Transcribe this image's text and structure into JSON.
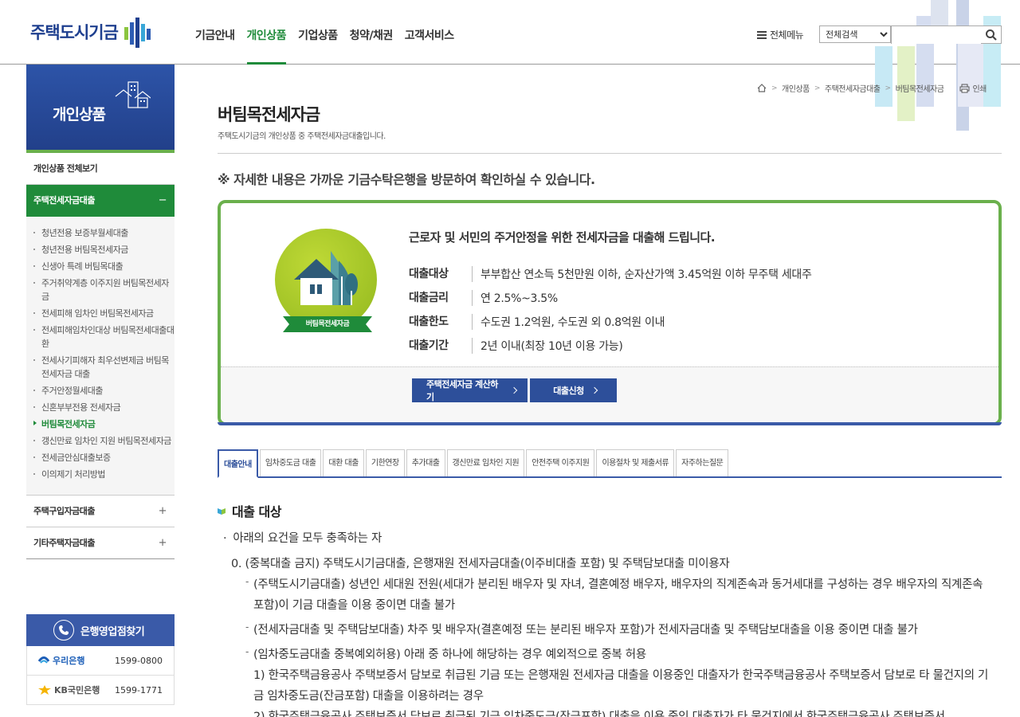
{
  "header": {
    "logo_text": "주택도시기금",
    "nav": [
      "기금안내",
      "개인상품",
      "기업상품",
      "청약/채권",
      "고객서비스"
    ],
    "nav_active_index": 1,
    "all_menu": "전체메뉴",
    "search_select": "전체검색",
    "search_placeholder": ""
  },
  "sidebar": {
    "title": "개인상품",
    "all_label": "개인상품 전체보기",
    "groups": [
      {
        "label": "주택전세자금대출",
        "toggle": "−",
        "items": [
          "청년전용 보증부월세대출",
          "청년전용 버팀목전세자금",
          "신생아 특례 버팀목대출",
          "주거취약계층 이주지원 버팀목전세자금",
          "전세피해 임차인 버팀목전세자금",
          "전세피해임차인대상 버팀목전세대출대환",
          "전세사기피해자 최우선변제금 버팀목 전세자금 대출",
          "주거안정월세대출",
          "신혼부부전용 전세자금",
          "버팀목전세자금",
          "갱신만료 임차인 지원 버팀목전세자금",
          "전세금안심대출보증",
          "이의제기 처리방법"
        ],
        "current_index": 9
      },
      {
        "label": "주택구입자금대출",
        "toggle": "+"
      },
      {
        "label": "기타주택자금대출",
        "toggle": "+"
      }
    ],
    "bank_finder": {
      "title": "은행영업점찾기",
      "banks": [
        {
          "name": "우리은행",
          "phone": "1599-0800"
        },
        {
          "name": "KB국민은행",
          "phone": "1599-1771"
        }
      ]
    }
  },
  "content": {
    "breadcrumb": [
      "개인상품",
      "주택전세자금대출",
      "버팀목전세자금"
    ],
    "print_label": "인쇄",
    "title": "버팀목전세자금",
    "description": "주택도시기금의 개인상품 중 주택전세자금대출입니다.",
    "notice": "※ 자세한 내용은 가까운 기금수탁은행을 방문하여 확인하실 수 있습니다.",
    "product": {
      "emblem_label": "버팀목전세자금",
      "headline": "근로자 및 서민의 주거안정을 위한 전세자금을 대출해 드립니다.",
      "rows": [
        {
          "label": "대출대상",
          "value": "부부합산 연소득 5천만원 이하, 순자산가액 3.45억원 이하 무주택 세대주"
        },
        {
          "label": "대출금리",
          "value": "연 2.5%~3.5%"
        },
        {
          "label": "대출한도",
          "value": "수도권 1.2억원, 수도권 외 0.8억원 이내"
        },
        {
          "label": "대출기간",
          "value": "2년 이내(최장 10년 이용 가능)"
        }
      ],
      "btn_calc": "주택전세자금 계산하기",
      "btn_apply": "대출신청"
    },
    "tabs": [
      "대출안내",
      "임차중도금 대출",
      "대환 대출",
      "기한연장",
      "추가대출",
      "갱신만료 임차인 지원",
      "안전주택 이주지원",
      "이용절차 및 제출서류",
      "자주하는질문"
    ],
    "tab_active_index": 0,
    "section": {
      "title": "대출 대상",
      "bullet": "아래의 요건을 모두 충족하는 자",
      "item0": "0. (중복대출 금지) 주택도시기금대출, 은행재원 전세자금대출(이주비대출 포함) 및 주택담보대출 미이용자",
      "dash1": "(주택도시기금대출) 성년인 세대원 전원(세대가 분리된 배우자 및 자녀, 결혼예정 배우자, 배우자의 직계존속과 동거세대를 구성하는 경우 배우자의 직계존속 포함)이 기금 대출을 이용 중이면 대출 불가",
      "dash2": "(전세자금대출 및 주택담보대출) 차주 및 배우자(결혼예정 또는 분리된 배우자 포함)가 전세자금대출 및 주택담보대출을 이용 중이면 대출 불가",
      "dash3": "(임차중도금대출 중복예외허용) 아래 중 하나에 해당하는 경우 예외적으로 중복 허용",
      "num1": "1) 한국주택금융공사 주택보증서 담보로 취급된 기금 또는 은행재원 전세자금 대출을 이용중인 대출자가 한국주택금융공사 주택보증서 담보로 타 물건지의 기금 임차중도금(잔금포함) 대출을 이용하려는 경우",
      "num2": "2) 한국주택금융공사 주택보증서 담보로 취급된 기금 임차중도금(잔금포함) 대출을 이용 중인 대출자가 타 물건지에서 한국주택금융공사 주택보증서"
    }
  }
}
